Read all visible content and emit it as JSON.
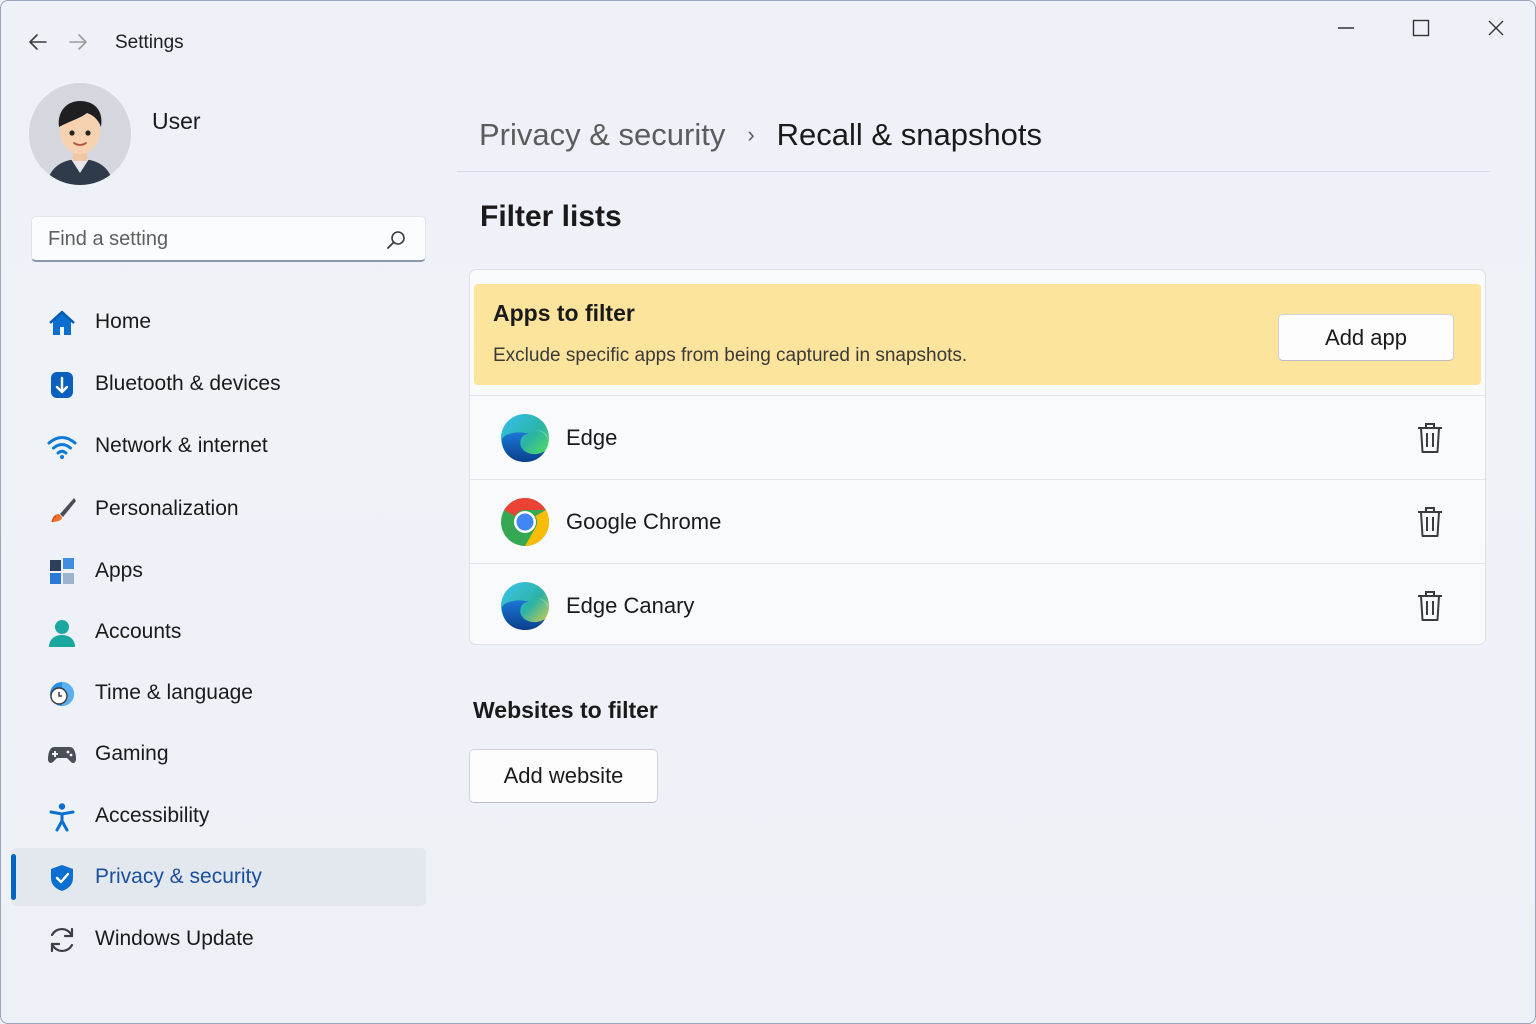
{
  "window": {
    "title": "Settings"
  },
  "user": {
    "name": "User"
  },
  "search": {
    "placeholder": "Find a setting"
  },
  "sidebar": {
    "items": [
      {
        "label": "Home",
        "icon": "home-icon"
      },
      {
        "label": "Bluetooth & devices",
        "icon": "bluetooth-icon"
      },
      {
        "label": "Network & internet",
        "icon": "wifi-icon"
      },
      {
        "label": "Personalization",
        "icon": "brush-icon"
      },
      {
        "label": "Apps",
        "icon": "apps-icon"
      },
      {
        "label": "Accounts",
        "icon": "person-icon"
      },
      {
        "label": "Time & language",
        "icon": "globe-clock-icon"
      },
      {
        "label": "Gaming",
        "icon": "gamepad-icon"
      },
      {
        "label": "Accessibility",
        "icon": "accessibility-icon"
      },
      {
        "label": "Privacy & security",
        "icon": "shield-icon",
        "active": true
      },
      {
        "label": "Windows Update",
        "icon": "update-icon"
      }
    ]
  },
  "breadcrumb": {
    "parent": "Privacy & security",
    "separator": "›",
    "current": "Recall & snapshots"
  },
  "main": {
    "section_title": "Filter lists",
    "apps_filter": {
      "title": "Apps to filter",
      "description": "Exclude specific apps from being captured in snapshots.",
      "add_button": "Add app",
      "apps": [
        {
          "name": "Edge",
          "icon": "edge-icon"
        },
        {
          "name": "Google Chrome",
          "icon": "chrome-icon"
        },
        {
          "name": "Edge Canary",
          "icon": "edge-canary-icon"
        }
      ]
    },
    "websites_filter": {
      "title": "Websites to filter",
      "add_button": "Add website"
    }
  },
  "colors": {
    "accent": "#0067c0",
    "banner": "#fde49c",
    "active_nav_bg": "#e3e8ef"
  }
}
